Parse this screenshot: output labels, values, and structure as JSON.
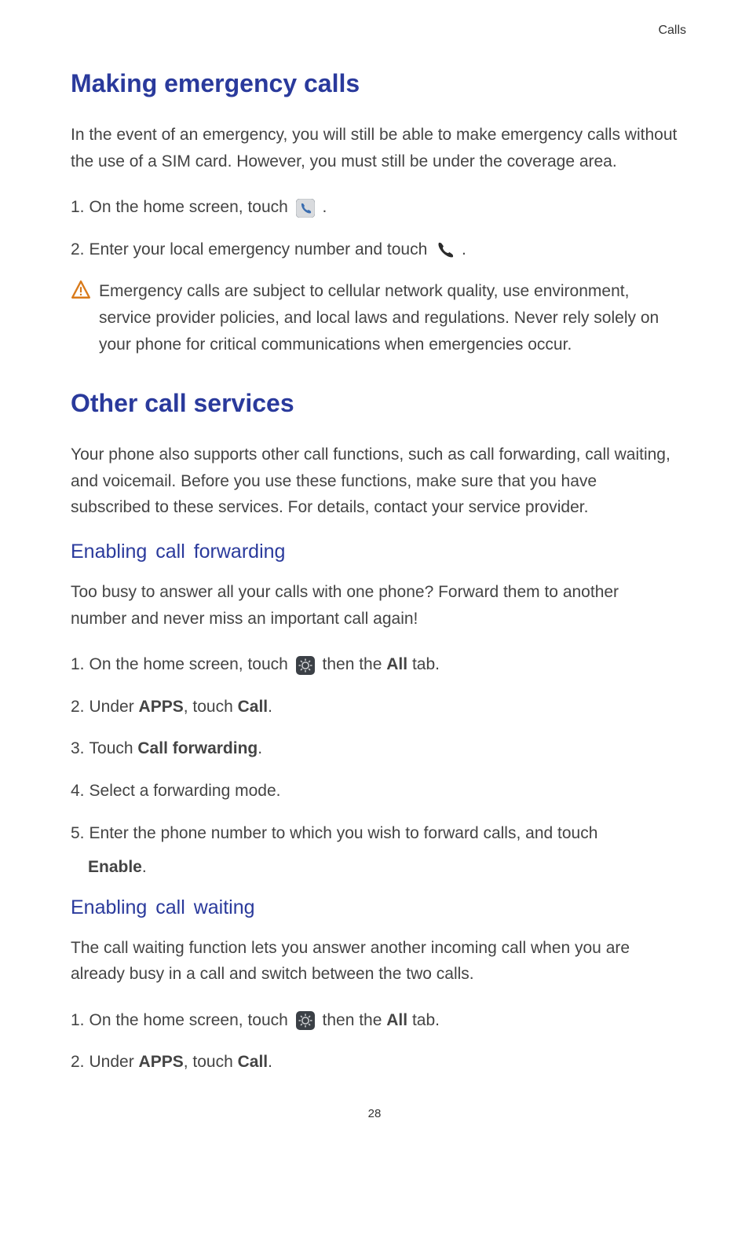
{
  "header": {
    "section": "Calls"
  },
  "sections": {
    "emergency": {
      "title": "Making emergency calls",
      "intro": "In the event of an emergency, you will still be able to make emergency calls without the use of a SIM card. However, you must still be under the coverage area.",
      "step1_pre": "On the home screen, touch ",
      "step1_post": " .",
      "step2_pre": "Enter your local emergency number and touch ",
      "step2_post": " .",
      "warning": "Emergency calls are subject to cellular network quality, use environment, service provider policies, and local laws and regulations. Never rely solely on your phone for critical communications when emergencies occur."
    },
    "other": {
      "title": "Other call services",
      "intro": "Your phone also supports other call functions, such as call forwarding, call waiting, and voicemail. Before you use these functions, make sure that you have subscribed to these services. For details, contact your service provider.",
      "forwarding": {
        "title": "Enabling call forwarding",
        "intro": "Too busy to answer all your calls with one phone? Forward them to another number and never miss an important call again!",
        "s1_pre": "On the home screen, touch ",
        "s1_mid": " then the ",
        "s1_bold": "All",
        "s1_post": " tab.",
        "s2_pre": "Under ",
        "s2_bold1": "APPS",
        "s2_mid": ", touch ",
        "s2_bold2": "Call",
        "s2_post": ".",
        "s3_pre": "Touch ",
        "s3_bold": "Call forwarding",
        "s3_post": ".",
        "s4": "Select a forwarding mode.",
        "s5_line1": "Enter the phone number to which you wish to forward calls, and touch",
        "s5_line2_bold": "Enable",
        "s5_line2_post": "."
      },
      "waiting": {
        "title": "Enabling call waiting",
        "intro": "The call waiting function lets you answer another incoming call when you are already busy in a call and switch between the two calls.",
        "s1_pre": "On the home screen, touch ",
        "s1_mid": " then the ",
        "s1_bold": "All",
        "s1_post": " tab.",
        "s2_pre": "Under ",
        "s2_bold1": "APPS",
        "s2_mid": ", touch ",
        "s2_bold2": "Call",
        "s2_post": "."
      }
    }
  },
  "labels": {
    "n1": "1.",
    "n2": "2.",
    "n3": "3.",
    "n4": "4.",
    "n5": "5."
  },
  "footer": {
    "page": "28"
  }
}
